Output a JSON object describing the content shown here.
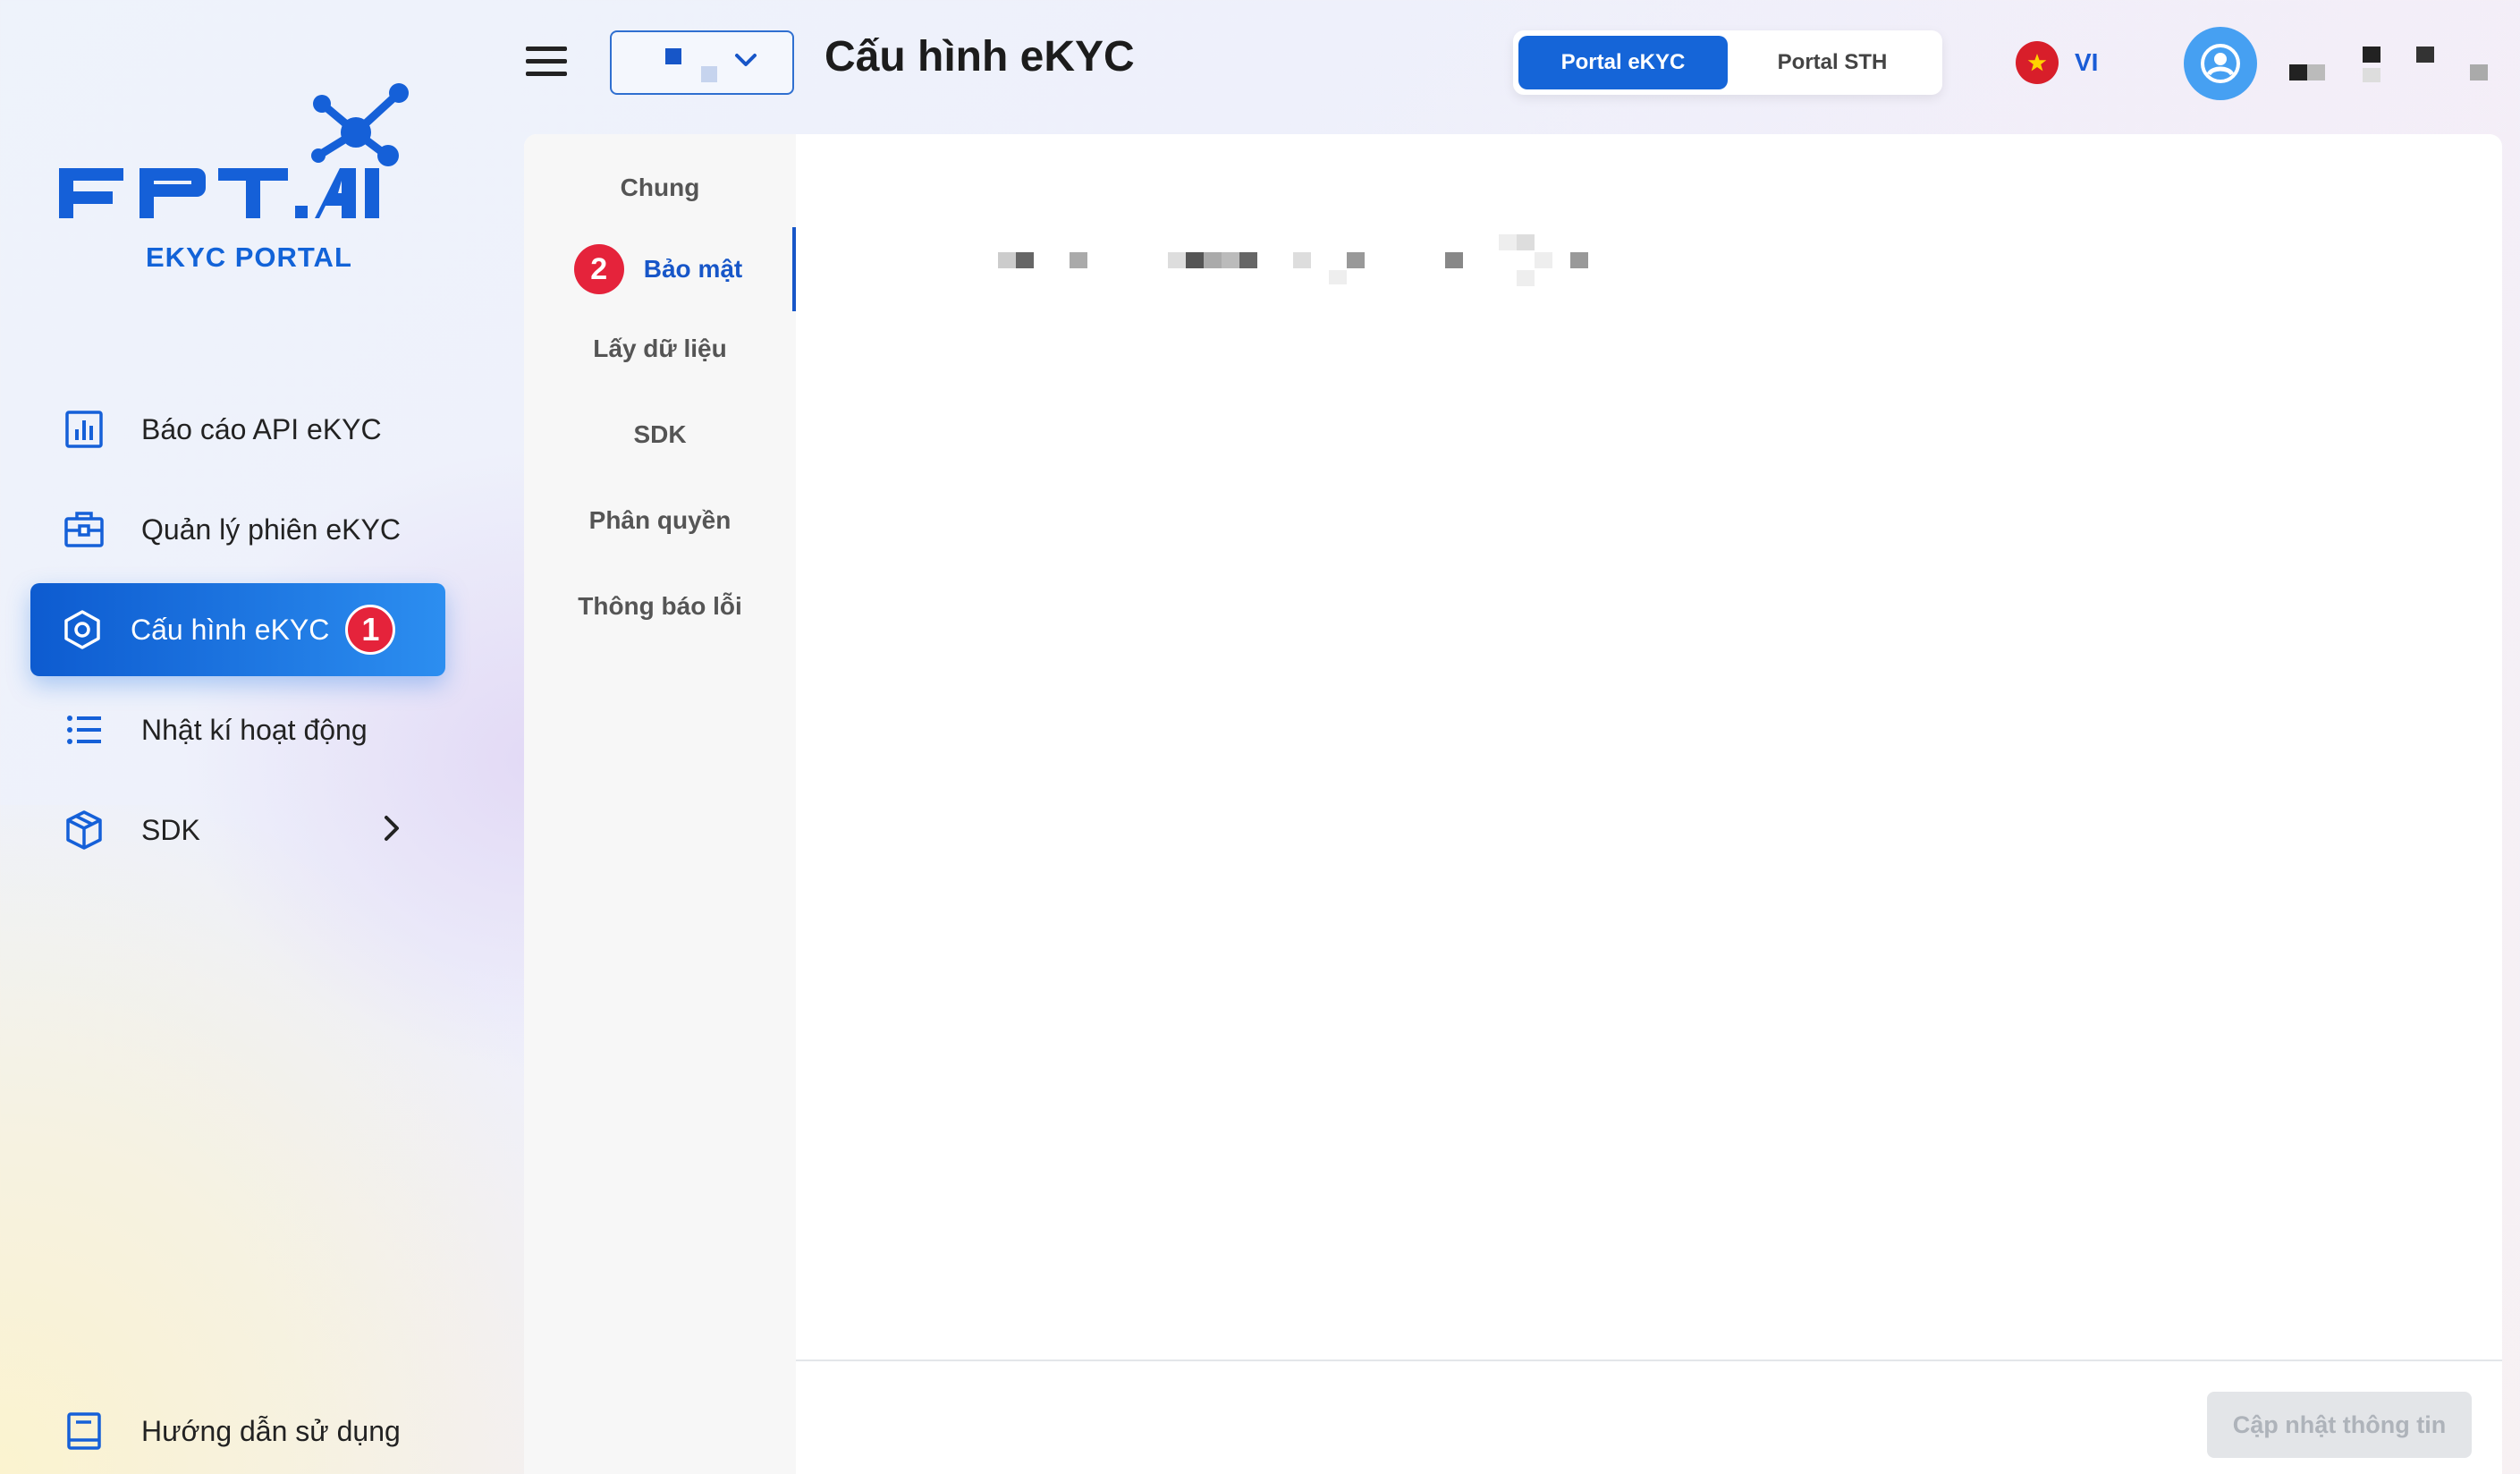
{
  "app": {
    "logo_subtitle": "EKYC PORTAL"
  },
  "sidebar": {
    "items": [
      {
        "label": "Báo cáo API eKYC",
        "icon": "bar-chart-icon",
        "active": false
      },
      {
        "label": "Quản lý phiên eKYC",
        "icon": "briefcase-icon",
        "active": false
      },
      {
        "label": "Cấu hình eKYC",
        "icon": "hexagon-settings-icon",
        "active": true,
        "badge": "1"
      },
      {
        "label": "Nhật kí hoạt động",
        "icon": "list-icon",
        "active": false
      },
      {
        "label": "SDK",
        "icon": "cube-icon",
        "active": false,
        "has_submenu": true
      }
    ],
    "footer_item": {
      "label": "Hướng dẫn sử dụng",
      "icon": "book-icon"
    }
  },
  "header": {
    "title": "Cấu hình eKYC",
    "portal_tabs": [
      {
        "label": "Portal eKYC",
        "active": true
      },
      {
        "label": "Portal STH",
        "active": false
      }
    ],
    "language": "VI"
  },
  "settings_nav": {
    "items": [
      {
        "label": "Chung",
        "active": false
      },
      {
        "label": "Bảo mật",
        "active": true,
        "badge": "2"
      },
      {
        "label": "Lấy dữ liệu",
        "active": false
      },
      {
        "label": "SDK",
        "active": false
      },
      {
        "label": "Phân quyền",
        "active": false
      },
      {
        "label": "Thông báo lỗi",
        "active": false
      }
    ]
  },
  "actions": {
    "update_label": "Cập nhật thông tin"
  },
  "colors": {
    "accent": "#1565d8",
    "badge": "#e5233b",
    "avatar": "#46a0f2"
  }
}
